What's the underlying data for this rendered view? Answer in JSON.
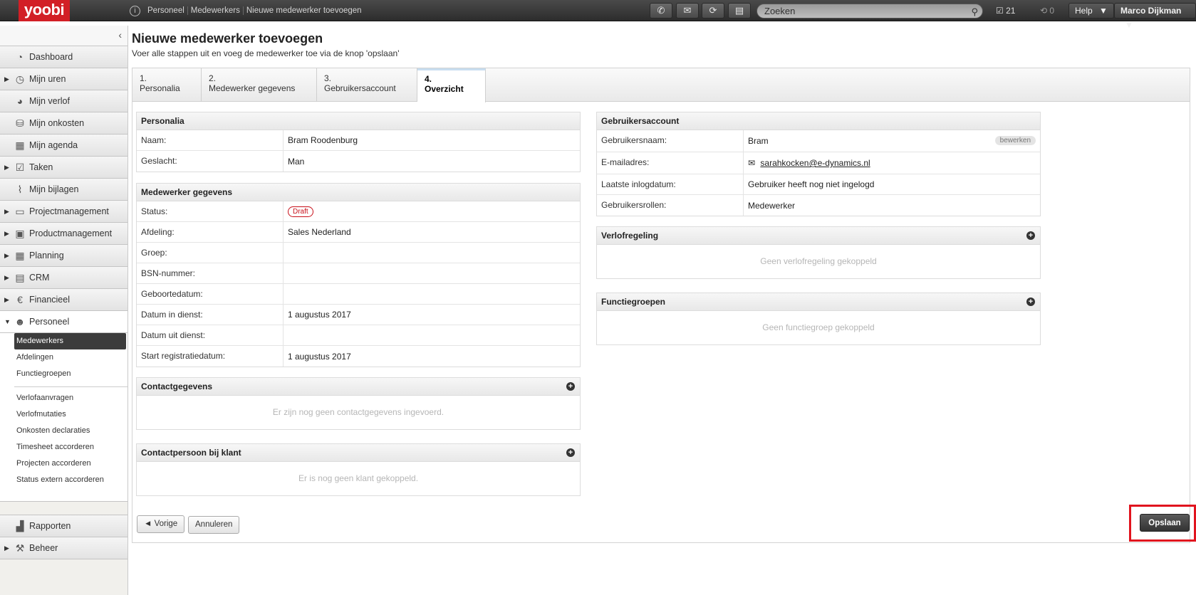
{
  "app": {
    "logo": "yoobi"
  },
  "breadcrumb": [
    "Personeel",
    "Medewerkers",
    "Nieuwe medewerker toevoegen"
  ],
  "topbar": {
    "search_placeholder": "Zoeken",
    "tasks_count": "21",
    "sync_count": "0",
    "help_label": "Help",
    "user_label": "Marco Dijkman"
  },
  "sidebar": {
    "items": [
      {
        "label": "Dashboard"
      },
      {
        "label": "Mijn uren"
      },
      {
        "label": "Mijn verlof"
      },
      {
        "label": "Mijn onkosten"
      },
      {
        "label": "Mijn agenda"
      },
      {
        "label": "Taken"
      },
      {
        "label": "Mijn bijlagen"
      },
      {
        "label": "Projectmanagement"
      },
      {
        "label": "Productmanagement"
      },
      {
        "label": "Planning"
      },
      {
        "label": "CRM"
      },
      {
        "label": "Financieel"
      },
      {
        "label": "Personeel"
      }
    ],
    "sub_items": [
      "Medewerkers",
      "Afdelingen",
      "Functiegroepen"
    ],
    "sub_items2": [
      "Verlofaanvragen",
      "Verlofmutaties",
      "Onkosten declaraties",
      "Timesheet accorderen",
      "Projecten accorderen",
      "Status extern accorderen"
    ],
    "bottom_items": [
      {
        "label": "Rapporten"
      },
      {
        "label": "Beheer"
      }
    ]
  },
  "page": {
    "title": "Nieuwe medewerker toevoegen",
    "subtitle": "Voer alle stappen uit en voeg de medewerker toe via de knop 'opslaan'"
  },
  "tabs": [
    {
      "num": "1.",
      "label": "Personalia"
    },
    {
      "num": "2.",
      "label": "Medewerker gegevens"
    },
    {
      "num": "3.",
      "label": "Gebruikersaccount"
    },
    {
      "num": "4.",
      "label": "Overzicht"
    }
  ],
  "personalia": {
    "title": "Personalia",
    "rows": [
      {
        "key": "Naam:",
        "value": "Bram Roodenburg"
      },
      {
        "key": "Geslacht:",
        "value": "Man"
      }
    ]
  },
  "medewerker": {
    "title": "Medewerker gegevens",
    "status_key": "Status:",
    "status_badge": "Draft",
    "rows": [
      {
        "key": "Afdeling:",
        "value": "Sales Nederland"
      },
      {
        "key": "Groep:",
        "value": ""
      },
      {
        "key": "BSN-nummer:",
        "value": ""
      },
      {
        "key": "Geboortedatum:",
        "value": ""
      },
      {
        "key": "Datum in dienst:",
        "value": "1 augustus 2017"
      },
      {
        "key": "Datum uit dienst:",
        "value": ""
      },
      {
        "key": "Start registratiedatum:",
        "value": "1 augustus 2017"
      }
    ]
  },
  "contact": {
    "title": "Contactgegevens",
    "empty": "Er zijn nog geen contactgegevens ingevoerd."
  },
  "contactpersoon": {
    "title": "Contactpersoon bij klant",
    "empty": "Er is nog geen klant gekoppeld."
  },
  "account": {
    "title": "Gebruikersaccount",
    "username_key": "Gebruikersnaam:",
    "username": "Bram",
    "edit_label": "bewerken",
    "email_key": "E-mailadres:",
    "email": "sarahkocken@e-dynamics.nl",
    "rows": [
      {
        "key": "Laatste inlogdatum:",
        "value": "Gebruiker heeft nog niet ingelogd"
      },
      {
        "key": "Gebruikersrollen:",
        "value": "Medewerker"
      }
    ]
  },
  "verlof": {
    "title": "Verlofregeling",
    "empty": "Geen verlofregeling gekoppeld"
  },
  "functie": {
    "title": "Functiegroepen",
    "empty": "Geen functiegroep gekoppeld"
  },
  "buttons": {
    "prev": "◄ Vorige",
    "cancel": "Annuleren",
    "save": "Opslaan"
  }
}
